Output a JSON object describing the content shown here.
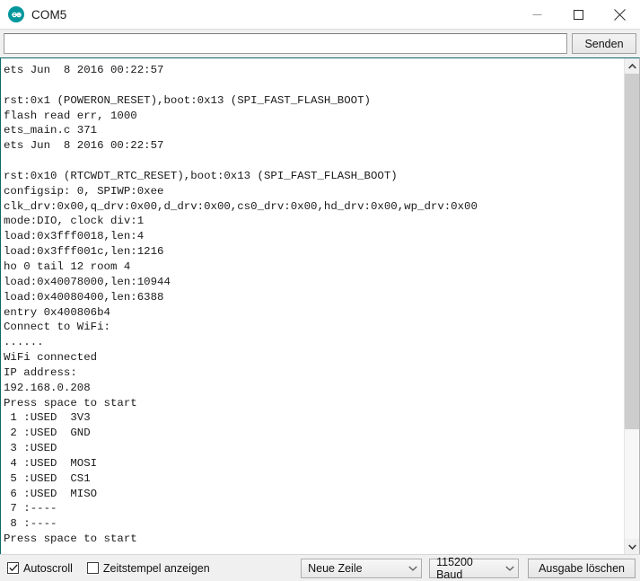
{
  "window": {
    "title": "COM5",
    "app_icon": "arduino-logo-icon",
    "accent_color": "#00979c",
    "caption": {
      "minimize": "minimize-icon",
      "maximize": "maximize-icon",
      "close": "close-icon"
    }
  },
  "send_row": {
    "input_value": "",
    "input_placeholder": "",
    "send_label": "Senden"
  },
  "console": {
    "lines": [
      "ets Jun  8 2016 00:22:57",
      "",
      "rst:0x1 (POWERON_RESET),boot:0x13 (SPI_FAST_FLASH_BOOT)",
      "flash read err, 1000",
      "ets_main.c 371",
      "ets Jun  8 2016 00:22:57",
      "",
      "rst:0x10 (RTCWDT_RTC_RESET),boot:0x13 (SPI_FAST_FLASH_BOOT)",
      "configsip: 0, SPIWP:0xee",
      "clk_drv:0x00,q_drv:0x00,d_drv:0x00,cs0_drv:0x00,hd_drv:0x00,wp_drv:0x00",
      "mode:DIO, clock div:1",
      "load:0x3fff0018,len:4",
      "load:0x3fff001c,len:1216",
      "ho 0 tail 12 room 4",
      "load:0x40078000,len:10944",
      "load:0x40080400,len:6388",
      "entry 0x400806b4",
      "Connect to WiFi:",
      "......",
      "WiFi connected",
      "IP address:",
      "192.168.0.208",
      "Press space to start",
      " 1 :USED  3V3",
      " 2 :USED  GND",
      " 3 :USED",
      " 4 :USED  MOSI",
      " 5 :USED  CS1",
      " 6 :USED  MISO",
      " 7 :----",
      " 8 :----",
      "Press space to start"
    ]
  },
  "scrollbar": {
    "up_arrow": "chevron-up-icon",
    "down_arrow": "chevron-down-icon",
    "thumb_position_percent": 0,
    "thumb_size_percent": 76.5
  },
  "footer": {
    "autoscroll_label": "Autoscroll",
    "autoscroll_checked": true,
    "timestamp_label": "Zeitstempel anzeigen",
    "timestamp_checked": false,
    "line_ending_value": "Neue Zeile",
    "baud_value": "115200 Baud",
    "clear_label": "Ausgabe löschen"
  }
}
